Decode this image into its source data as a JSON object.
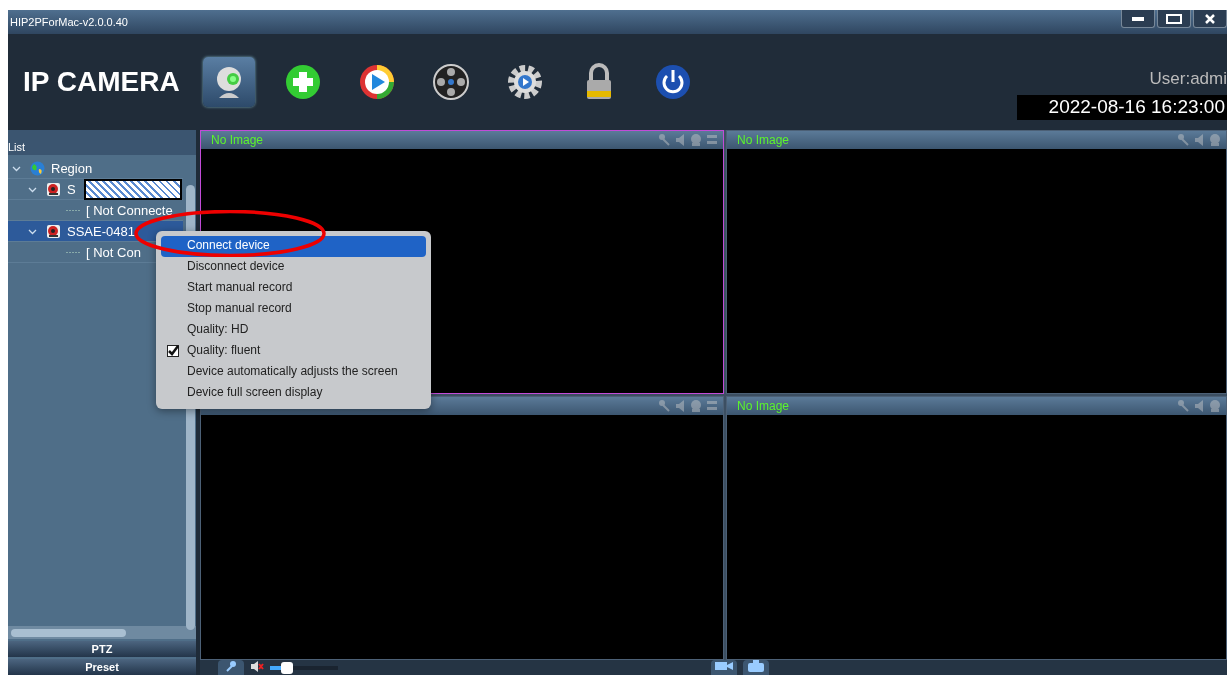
{
  "window": {
    "title": "HIP2PForMac-v2.0.0.40"
  },
  "header": {
    "logo": "IP CAMERA",
    "toolbar": [
      {
        "kind": "webcam",
        "selected": true
      },
      {
        "kind": "add",
        "selected": false
      },
      {
        "kind": "play",
        "selected": false
      },
      {
        "kind": "reel",
        "selected": false
      },
      {
        "kind": "settings",
        "selected": false
      },
      {
        "kind": "lock",
        "selected": false
      },
      {
        "kind": "power",
        "selected": false
      }
    ],
    "user": "User:admi",
    "datetime": "2022-08-16 16:23:00"
  },
  "sidebar": {
    "title": "List",
    "tree": [
      {
        "label": "Region",
        "kind": "region",
        "expanded": true,
        "selected": false,
        "children": [
          {
            "label": "S",
            "kind": "device",
            "redacted": true,
            "expanded": true,
            "selected": false,
            "children": [
              {
                "label": "[ Not Connecte",
                "kind": "status",
                "selected": false
              }
            ]
          },
          {
            "label": "SSAE-0481",
            "kind": "device",
            "expanded": true,
            "selected": true,
            "children": [
              {
                "label": "[ Not Con",
                "kind": "status",
                "selected": false
              }
            ]
          }
        ]
      }
    ],
    "buttons": [
      "PTZ",
      "Preset"
    ]
  },
  "panes": [
    {
      "title": "No Image",
      "selected": true
    },
    {
      "title": "No Image",
      "selected": false
    },
    {
      "selected": false
    },
    {
      "title": "No Image",
      "selected": false
    }
  ],
  "context_menu": {
    "items": [
      {
        "label": "Connect device",
        "selected": true,
        "checked": false
      },
      {
        "label": "Disconnect device",
        "selected": false,
        "checked": false
      },
      {
        "label": "Start manual record",
        "selected": false,
        "checked": false
      },
      {
        "label": "Stop manual record",
        "selected": false,
        "checked": false
      },
      {
        "label": "Quality: HD",
        "selected": false,
        "checked": false
      },
      {
        "label": "Quality: fluent",
        "selected": false,
        "checked": true
      },
      {
        "label": "Device automatically adjusts the screen",
        "selected": false,
        "checked": false
      },
      {
        "label": "Device full screen display",
        "selected": false,
        "checked": false
      }
    ]
  },
  "bottom_bar": {
    "volume": {
      "level": 0.25,
      "muted": true
    }
  }
}
